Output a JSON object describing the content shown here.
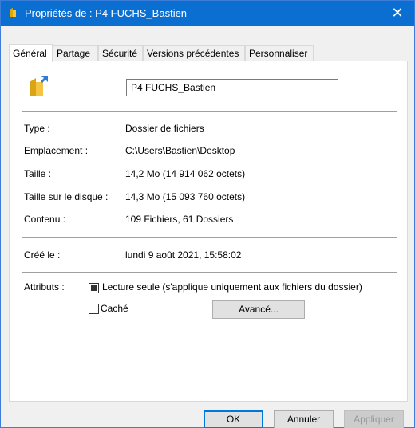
{
  "window": {
    "title": "Propriétés de : P4 FUCHS_Bastien",
    "close_glyph": "✕"
  },
  "tabs": [
    {
      "label": "Général",
      "active": true
    },
    {
      "label": "Partage",
      "active": false
    },
    {
      "label": "Sécurité",
      "active": false
    },
    {
      "label": "Versions précédentes",
      "active": false
    },
    {
      "label": "Personnaliser",
      "active": false
    }
  ],
  "general": {
    "name_value": "P4 FUCHS_Bastien",
    "props": [
      {
        "label": "Type :",
        "value": "Dossier de fichiers"
      },
      {
        "label": "Emplacement :",
        "value": "C:\\Users\\Bastien\\Desktop"
      },
      {
        "label": "Taille :",
        "value": "14,2 Mo (14 914 062 octets)"
      },
      {
        "label": "Taille sur le disque :",
        "value": "14,3 Mo (15 093 760 octets)"
      },
      {
        "label": "Contenu :",
        "value": "109 Fichiers, 61 Dossiers"
      }
    ],
    "created": {
      "label": "Créé le :",
      "value": "lundi 9 août 2021, 15:58:02"
    },
    "attributes": {
      "label": "Attributs :",
      "readonly_label": "Lecture seule (s'applique uniquement aux fichiers du dossier)",
      "readonly_state": "indeterminate",
      "hidden_label": "Caché",
      "hidden_checked": false,
      "advanced_label": "Avancé..."
    }
  },
  "buttons": {
    "ok": "OK",
    "cancel": "Annuler",
    "apply": "Appliquer"
  },
  "colors": {
    "titlebar": "#0a6fd1",
    "folder": "#f4c542"
  }
}
